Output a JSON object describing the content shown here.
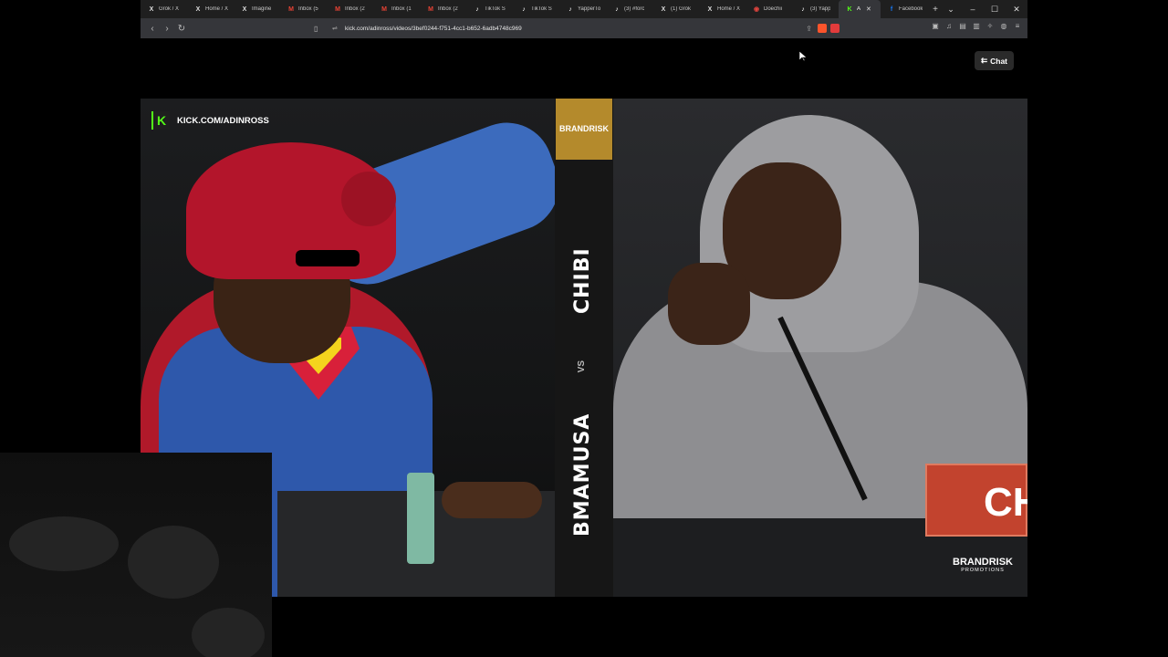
{
  "browser": {
    "tabs": [
      {
        "icon": "x-icon",
        "label": "Grok / X"
      },
      {
        "icon": "x-icon",
        "label": "Home / X"
      },
      {
        "icon": "x-icon",
        "label": "Imagine"
      },
      {
        "icon": "gmail-icon",
        "label": "Inbox (5"
      },
      {
        "icon": "gmail-icon",
        "label": "Inbox (2"
      },
      {
        "icon": "gmail-icon",
        "label": "Inbox (1"
      },
      {
        "icon": "gmail-icon",
        "label": "Inbox (2"
      },
      {
        "icon": "tiktok-icon",
        "label": "TikTok S"
      },
      {
        "icon": "tiktok-icon",
        "label": "TikTok S"
      },
      {
        "icon": "tiktok-icon",
        "label": "YapperTo"
      },
      {
        "icon": "tiktok-icon",
        "label": "(3) #forc"
      },
      {
        "icon": "x-icon",
        "label": "(1) Grok"
      },
      {
        "icon": "x-icon",
        "label": "Home / X"
      },
      {
        "icon": "globe-icon",
        "label": "Doechii"
      },
      {
        "icon": "tiktok-icon",
        "label": "(3) Yapp"
      },
      {
        "icon": "kick-icon",
        "label": "A",
        "active": true
      },
      {
        "icon": "facebook-icon",
        "label": "Facebook"
      }
    ],
    "url": "kick.com/adinross/videos/3bef0244-f751-4cc1-b652-6adb4748c969"
  },
  "page": {
    "chat_label": "Chat"
  },
  "video": {
    "channel_badge": "KICK.COM/ADINROSS",
    "promo_logo": "BRANDRISK",
    "fighter_top": "CHIBI",
    "versus": "VS",
    "fighter_bottom": "BMAMUSA",
    "nameplate_text": "CH",
    "corner_brand": "BRANDRISK",
    "corner_brand_sub": "PROMOTIONS"
  }
}
